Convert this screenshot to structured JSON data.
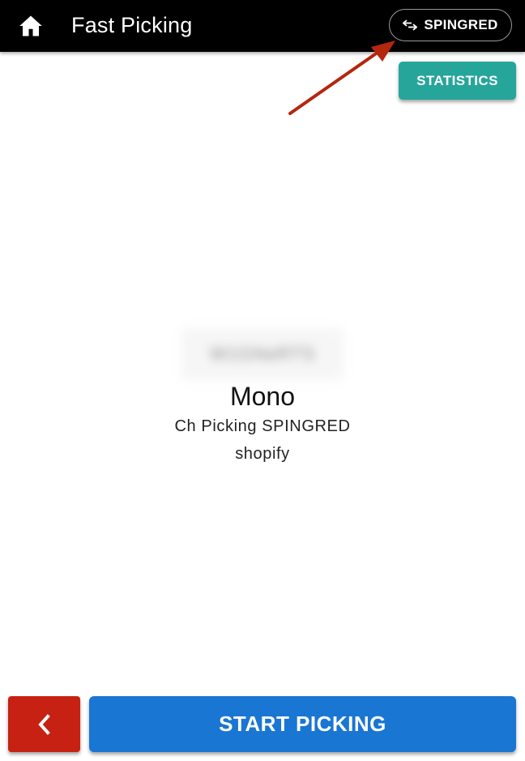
{
  "header": {
    "title": "Fast Picking",
    "home_icon": "home-icon",
    "channel_switch": {
      "label": "SPINGRED",
      "icon": "swap-arrows-icon"
    }
  },
  "actions": {
    "statistics_label": "STATISTICS",
    "back_icon": "chevron-left-icon",
    "start_label": "START PICKING"
  },
  "info": {
    "blurred_code": "W1GNeRTS",
    "warehouse": "Mono",
    "channel": "Ch Picking SPINGRED",
    "source": "shopify"
  },
  "colors": {
    "appbar": "#000000",
    "statistics": "#26a69a",
    "back": "#c62112",
    "start": "#1976d2",
    "annotation_arrow": "#b5260f"
  }
}
